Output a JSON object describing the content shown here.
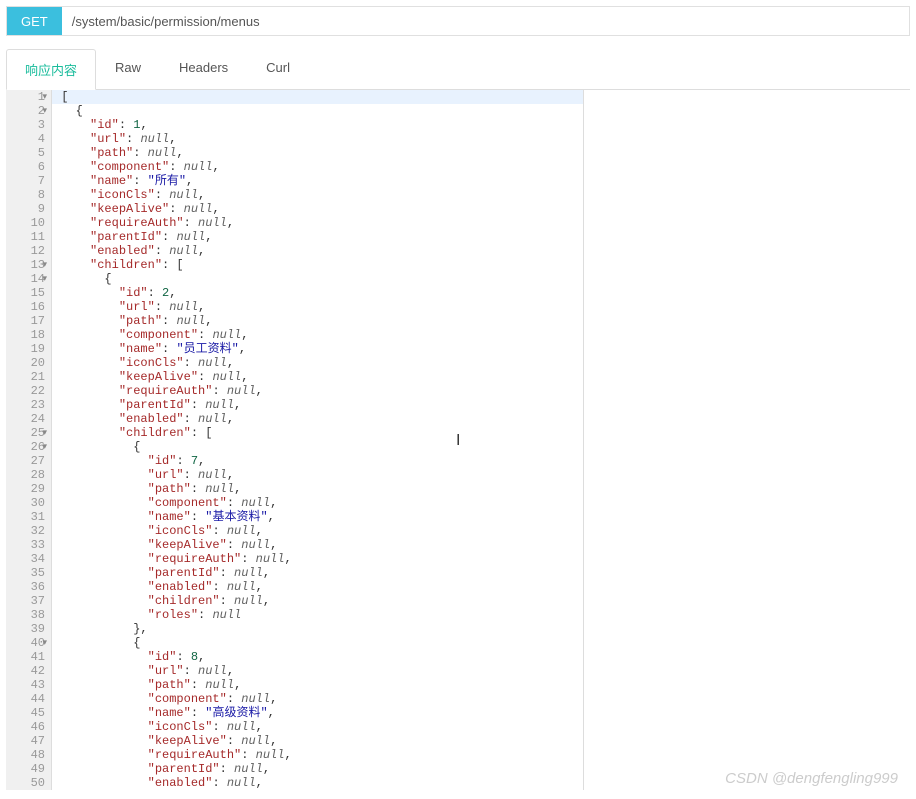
{
  "http": {
    "method": "GET",
    "url": "/system/basic/permission/menus"
  },
  "tabs": [
    {
      "label": "响应内容",
      "active": true
    },
    {
      "label": "Raw",
      "active": false
    },
    {
      "label": "Headers",
      "active": false
    },
    {
      "label": "Curl",
      "active": false
    }
  ],
  "watermark": "CSDN @dengfengling999",
  "code": {
    "lineStart": 1,
    "lineEnd": 50,
    "activeLine": 1,
    "foldableLines": [
      1,
      2,
      13,
      14,
      25,
      26,
      40
    ],
    "lines": [
      {
        "n": 1,
        "indent": 0,
        "tokens": [
          [
            "punct",
            "["
          ]
        ]
      },
      {
        "n": 2,
        "indent": 1,
        "tokens": [
          [
            "punct",
            "{"
          ]
        ]
      },
      {
        "n": 3,
        "indent": 2,
        "tokens": [
          [
            "key",
            "\"id\""
          ],
          [
            "punct",
            ": "
          ],
          [
            "num",
            "1"
          ],
          [
            "punct",
            ","
          ]
        ]
      },
      {
        "n": 4,
        "indent": 2,
        "tokens": [
          [
            "key",
            "\"url\""
          ],
          [
            "punct",
            ": "
          ],
          [
            "null",
            "null"
          ],
          [
            "punct",
            ","
          ]
        ]
      },
      {
        "n": 5,
        "indent": 2,
        "tokens": [
          [
            "key",
            "\"path\""
          ],
          [
            "punct",
            ": "
          ],
          [
            "null",
            "null"
          ],
          [
            "punct",
            ","
          ]
        ]
      },
      {
        "n": 6,
        "indent": 2,
        "tokens": [
          [
            "key",
            "\"component\""
          ],
          [
            "punct",
            ": "
          ],
          [
            "null",
            "null"
          ],
          [
            "punct",
            ","
          ]
        ]
      },
      {
        "n": 7,
        "indent": 2,
        "tokens": [
          [
            "key",
            "\"name\""
          ],
          [
            "punct",
            ": "
          ],
          [
            "string",
            "\"所有\""
          ],
          [
            "punct",
            ","
          ]
        ]
      },
      {
        "n": 8,
        "indent": 2,
        "tokens": [
          [
            "key",
            "\"iconCls\""
          ],
          [
            "punct",
            ": "
          ],
          [
            "null",
            "null"
          ],
          [
            "punct",
            ","
          ]
        ]
      },
      {
        "n": 9,
        "indent": 2,
        "tokens": [
          [
            "key",
            "\"keepAlive\""
          ],
          [
            "punct",
            ": "
          ],
          [
            "null",
            "null"
          ],
          [
            "punct",
            ","
          ]
        ]
      },
      {
        "n": 10,
        "indent": 2,
        "tokens": [
          [
            "key",
            "\"requireAuth\""
          ],
          [
            "punct",
            ": "
          ],
          [
            "null",
            "null"
          ],
          [
            "punct",
            ","
          ]
        ]
      },
      {
        "n": 11,
        "indent": 2,
        "tokens": [
          [
            "key",
            "\"parentId\""
          ],
          [
            "punct",
            ": "
          ],
          [
            "null",
            "null"
          ],
          [
            "punct",
            ","
          ]
        ]
      },
      {
        "n": 12,
        "indent": 2,
        "tokens": [
          [
            "key",
            "\"enabled\""
          ],
          [
            "punct",
            ": "
          ],
          [
            "null",
            "null"
          ],
          [
            "punct",
            ","
          ]
        ]
      },
      {
        "n": 13,
        "indent": 2,
        "tokens": [
          [
            "key",
            "\"children\""
          ],
          [
            "punct",
            ": ["
          ]
        ]
      },
      {
        "n": 14,
        "indent": 3,
        "tokens": [
          [
            "punct",
            "{"
          ]
        ]
      },
      {
        "n": 15,
        "indent": 4,
        "tokens": [
          [
            "key",
            "\"id\""
          ],
          [
            "punct",
            ": "
          ],
          [
            "num",
            "2"
          ],
          [
            "punct",
            ","
          ]
        ]
      },
      {
        "n": 16,
        "indent": 4,
        "tokens": [
          [
            "key",
            "\"url\""
          ],
          [
            "punct",
            ": "
          ],
          [
            "null",
            "null"
          ],
          [
            "punct",
            ","
          ]
        ]
      },
      {
        "n": 17,
        "indent": 4,
        "tokens": [
          [
            "key",
            "\"path\""
          ],
          [
            "punct",
            ": "
          ],
          [
            "null",
            "null"
          ],
          [
            "punct",
            ","
          ]
        ]
      },
      {
        "n": 18,
        "indent": 4,
        "tokens": [
          [
            "key",
            "\"component\""
          ],
          [
            "punct",
            ": "
          ],
          [
            "null",
            "null"
          ],
          [
            "punct",
            ","
          ]
        ]
      },
      {
        "n": 19,
        "indent": 4,
        "tokens": [
          [
            "key",
            "\"name\""
          ],
          [
            "punct",
            ": "
          ],
          [
            "string",
            "\"员工资料\""
          ],
          [
            "punct",
            ","
          ]
        ]
      },
      {
        "n": 20,
        "indent": 4,
        "tokens": [
          [
            "key",
            "\"iconCls\""
          ],
          [
            "punct",
            ": "
          ],
          [
            "null",
            "null"
          ],
          [
            "punct",
            ","
          ]
        ]
      },
      {
        "n": 21,
        "indent": 4,
        "tokens": [
          [
            "key",
            "\"keepAlive\""
          ],
          [
            "punct",
            ": "
          ],
          [
            "null",
            "null"
          ],
          [
            "punct",
            ","
          ]
        ]
      },
      {
        "n": 22,
        "indent": 4,
        "tokens": [
          [
            "key",
            "\"requireAuth\""
          ],
          [
            "punct",
            ": "
          ],
          [
            "null",
            "null"
          ],
          [
            "punct",
            ","
          ]
        ]
      },
      {
        "n": 23,
        "indent": 4,
        "tokens": [
          [
            "key",
            "\"parentId\""
          ],
          [
            "punct",
            ": "
          ],
          [
            "null",
            "null"
          ],
          [
            "punct",
            ","
          ]
        ]
      },
      {
        "n": 24,
        "indent": 4,
        "tokens": [
          [
            "key",
            "\"enabled\""
          ],
          [
            "punct",
            ": "
          ],
          [
            "null",
            "null"
          ],
          [
            "punct",
            ","
          ]
        ]
      },
      {
        "n": 25,
        "indent": 4,
        "tokens": [
          [
            "key",
            "\"children\""
          ],
          [
            "punct",
            ": ["
          ]
        ]
      },
      {
        "n": 26,
        "indent": 5,
        "tokens": [
          [
            "punct",
            "{"
          ]
        ]
      },
      {
        "n": 27,
        "indent": 6,
        "tokens": [
          [
            "key",
            "\"id\""
          ],
          [
            "punct",
            ": "
          ],
          [
            "num",
            "7"
          ],
          [
            "punct",
            ","
          ]
        ]
      },
      {
        "n": 28,
        "indent": 6,
        "tokens": [
          [
            "key",
            "\"url\""
          ],
          [
            "punct",
            ": "
          ],
          [
            "null",
            "null"
          ],
          [
            "punct",
            ","
          ]
        ]
      },
      {
        "n": 29,
        "indent": 6,
        "tokens": [
          [
            "key",
            "\"path\""
          ],
          [
            "punct",
            ": "
          ],
          [
            "null",
            "null"
          ],
          [
            "punct",
            ","
          ]
        ]
      },
      {
        "n": 30,
        "indent": 6,
        "tokens": [
          [
            "key",
            "\"component\""
          ],
          [
            "punct",
            ": "
          ],
          [
            "null",
            "null"
          ],
          [
            "punct",
            ","
          ]
        ]
      },
      {
        "n": 31,
        "indent": 6,
        "tokens": [
          [
            "key",
            "\"name\""
          ],
          [
            "punct",
            ": "
          ],
          [
            "string",
            "\"基本资料\""
          ],
          [
            "punct",
            ","
          ]
        ]
      },
      {
        "n": 32,
        "indent": 6,
        "tokens": [
          [
            "key",
            "\"iconCls\""
          ],
          [
            "punct",
            ": "
          ],
          [
            "null",
            "null"
          ],
          [
            "punct",
            ","
          ]
        ]
      },
      {
        "n": 33,
        "indent": 6,
        "tokens": [
          [
            "key",
            "\"keepAlive\""
          ],
          [
            "punct",
            ": "
          ],
          [
            "null",
            "null"
          ],
          [
            "punct",
            ","
          ]
        ]
      },
      {
        "n": 34,
        "indent": 6,
        "tokens": [
          [
            "key",
            "\"requireAuth\""
          ],
          [
            "punct",
            ": "
          ],
          [
            "null",
            "null"
          ],
          [
            "punct",
            ","
          ]
        ]
      },
      {
        "n": 35,
        "indent": 6,
        "tokens": [
          [
            "key",
            "\"parentId\""
          ],
          [
            "punct",
            ": "
          ],
          [
            "null",
            "null"
          ],
          [
            "punct",
            ","
          ]
        ]
      },
      {
        "n": 36,
        "indent": 6,
        "tokens": [
          [
            "key",
            "\"enabled\""
          ],
          [
            "punct",
            ": "
          ],
          [
            "null",
            "null"
          ],
          [
            "punct",
            ","
          ]
        ]
      },
      {
        "n": 37,
        "indent": 6,
        "tokens": [
          [
            "key",
            "\"children\""
          ],
          [
            "punct",
            ": "
          ],
          [
            "null",
            "null"
          ],
          [
            "punct",
            ","
          ]
        ]
      },
      {
        "n": 38,
        "indent": 6,
        "tokens": [
          [
            "key",
            "\"roles\""
          ],
          [
            "punct",
            ": "
          ],
          [
            "null",
            "null"
          ]
        ]
      },
      {
        "n": 39,
        "indent": 5,
        "tokens": [
          [
            "punct",
            "},"
          ]
        ]
      },
      {
        "n": 40,
        "indent": 5,
        "tokens": [
          [
            "punct",
            "{"
          ]
        ]
      },
      {
        "n": 41,
        "indent": 6,
        "tokens": [
          [
            "key",
            "\"id\""
          ],
          [
            "punct",
            ": "
          ],
          [
            "num",
            "8"
          ],
          [
            "punct",
            ","
          ]
        ]
      },
      {
        "n": 42,
        "indent": 6,
        "tokens": [
          [
            "key",
            "\"url\""
          ],
          [
            "punct",
            ": "
          ],
          [
            "null",
            "null"
          ],
          [
            "punct",
            ","
          ]
        ]
      },
      {
        "n": 43,
        "indent": 6,
        "tokens": [
          [
            "key",
            "\"path\""
          ],
          [
            "punct",
            ": "
          ],
          [
            "null",
            "null"
          ],
          [
            "punct",
            ","
          ]
        ]
      },
      {
        "n": 44,
        "indent": 6,
        "tokens": [
          [
            "key",
            "\"component\""
          ],
          [
            "punct",
            ": "
          ],
          [
            "null",
            "null"
          ],
          [
            "punct",
            ","
          ]
        ]
      },
      {
        "n": 45,
        "indent": 6,
        "tokens": [
          [
            "key",
            "\"name\""
          ],
          [
            "punct",
            ": "
          ],
          [
            "string",
            "\"高级资料\""
          ],
          [
            "punct",
            ","
          ]
        ]
      },
      {
        "n": 46,
        "indent": 6,
        "tokens": [
          [
            "key",
            "\"iconCls\""
          ],
          [
            "punct",
            ": "
          ],
          [
            "null",
            "null"
          ],
          [
            "punct",
            ","
          ]
        ]
      },
      {
        "n": 47,
        "indent": 6,
        "tokens": [
          [
            "key",
            "\"keepAlive\""
          ],
          [
            "punct",
            ": "
          ],
          [
            "null",
            "null"
          ],
          [
            "punct",
            ","
          ]
        ]
      },
      {
        "n": 48,
        "indent": 6,
        "tokens": [
          [
            "key",
            "\"requireAuth\""
          ],
          [
            "punct",
            ": "
          ],
          [
            "null",
            "null"
          ],
          [
            "punct",
            ","
          ]
        ]
      },
      {
        "n": 49,
        "indent": 6,
        "tokens": [
          [
            "key",
            "\"parentId\""
          ],
          [
            "punct",
            ": "
          ],
          [
            "null",
            "null"
          ],
          [
            "punct",
            ","
          ]
        ]
      },
      {
        "n": 50,
        "indent": 6,
        "tokens": [
          [
            "key",
            "\"enabled\""
          ],
          [
            "punct",
            ": "
          ],
          [
            "null",
            "null"
          ],
          [
            "punct",
            ","
          ]
        ]
      }
    ]
  }
}
